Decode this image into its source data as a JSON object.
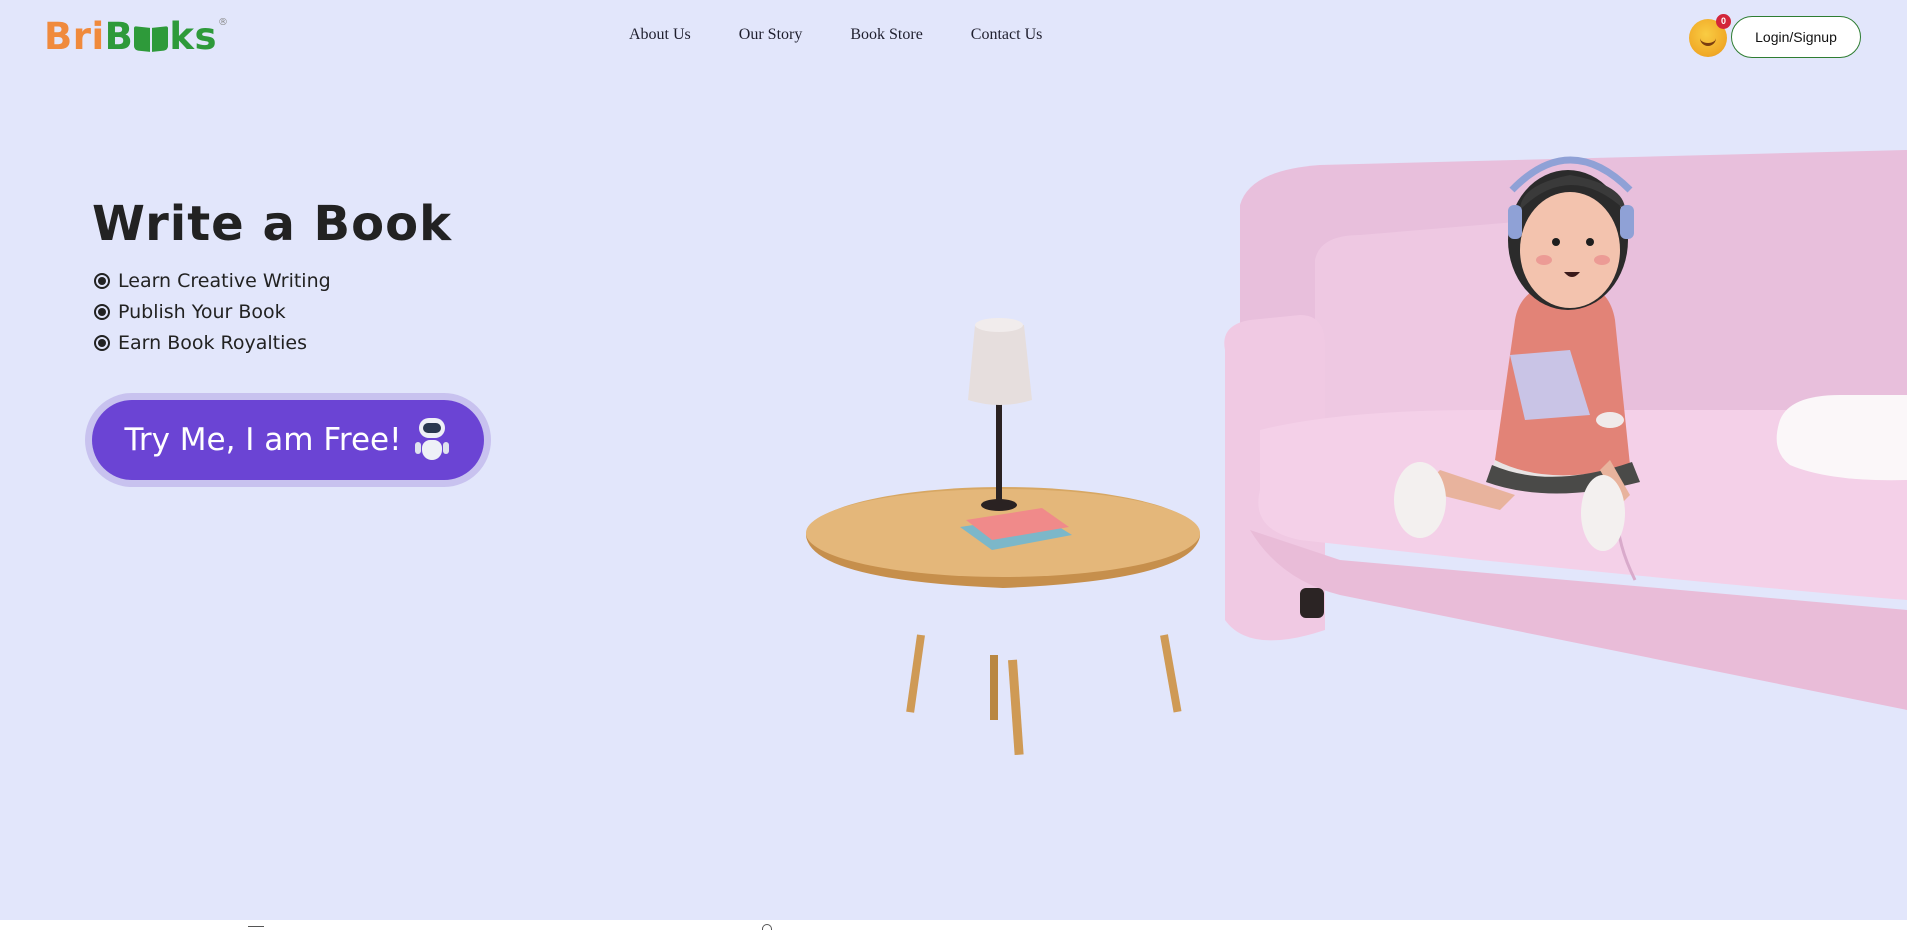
{
  "navbar": {
    "logo": {
      "part1": "Bri",
      "part2": "B",
      "part3": "ks",
      "reg": "®"
    },
    "links": [
      "About Us",
      "Our Story",
      "Book Store",
      "Contact Us"
    ],
    "notification_count": "0",
    "login_label": "Login/Signup"
  },
  "hero": {
    "title": "Write a Book",
    "features": [
      "Learn Creative Writing",
      "Publish Your Book",
      "Earn Book Royalties"
    ],
    "cta_label": "Try Me, I am Free!"
  },
  "icons": {
    "logo_book": "open-book-icon",
    "avatar": "smiley-avatar-icon",
    "cta": "robot-icon",
    "bullets": "radio-bullet-icon"
  },
  "colors": {
    "background": "#e2e6fb",
    "logo_orange": "#f08a3c",
    "logo_green": "#2e9a3a",
    "cta_purple": "#6b44d4",
    "login_border": "#2e7d32",
    "badge_red": "#d3263a"
  }
}
